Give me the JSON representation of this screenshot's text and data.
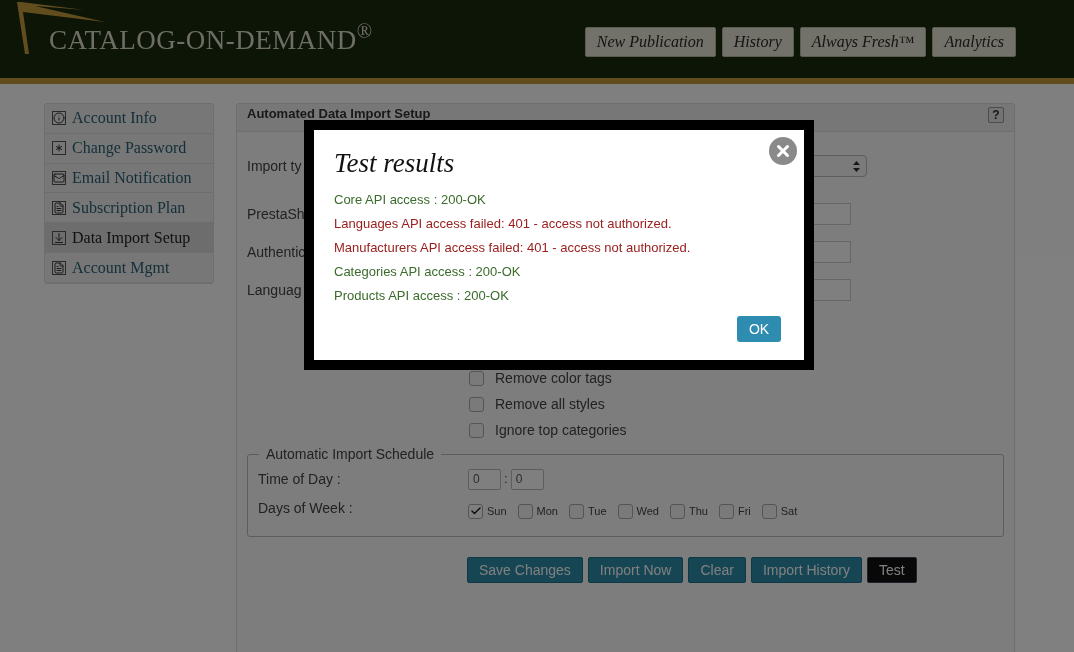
{
  "header": {
    "logo": "CATALOG-ON-DEMAND$^{®}$",
    "nav": [
      {
        "label": "New Publication"
      },
      {
        "label": "History"
      },
      {
        "label": "Always Fresh™"
      },
      {
        "label": "Analytics"
      }
    ]
  },
  "sidebar": {
    "items": [
      {
        "label": "Account Info",
        "selected": false
      },
      {
        "label": "Change Password",
        "selected": false
      },
      {
        "label": "Email Notification",
        "selected": false
      },
      {
        "label": "Subscription Plan",
        "selected": false
      },
      {
        "label": "Data Import Setup",
        "selected": true
      },
      {
        "label": "Account Mgmt",
        "selected": false
      }
    ]
  },
  "panel": {
    "title": "Automated Data Import Setup",
    "help": "?",
    "fields": [
      {
        "label": "Import ty",
        "kind": "select"
      },
      {
        "label": "PrestaSh",
        "kind": "input"
      },
      {
        "label": "Authentic",
        "kind": "input"
      },
      {
        "label": "Languag",
        "kind": "input"
      }
    ],
    "options": [
      {
        "label": "Remove color tags",
        "checked": false
      },
      {
        "label": "Remove all styles",
        "checked": false
      },
      {
        "label": "Ignore top categories",
        "checked": false
      }
    ],
    "schedule": {
      "legend": "Automatic Import Schedule",
      "time_label": "Time of Day :",
      "hour": "0",
      "separator": ":",
      "minute": "0",
      "days_label": "Days of Week :",
      "days": [
        {
          "label": "Sun",
          "checked": true
        },
        {
          "label": "Mon",
          "checked": false
        },
        {
          "label": "Tue",
          "checked": false
        },
        {
          "label": "Wed",
          "checked": false
        },
        {
          "label": "Thu",
          "checked": false
        },
        {
          "label": "Fri",
          "checked": false
        },
        {
          "label": "Sat",
          "checked": false
        }
      ]
    },
    "buttons": [
      {
        "label": "Save Changes",
        "kind": "primary"
      },
      {
        "label": "Import Now",
        "kind": "primary"
      },
      {
        "label": "Clear",
        "kind": "primary"
      },
      {
        "label": "Import History",
        "kind": "primary"
      },
      {
        "label": "Test",
        "kind": "dark"
      }
    ]
  },
  "dialog": {
    "title": "Test results",
    "results": [
      {
        "text": "Core API access : 200-OK",
        "kind": "ok"
      },
      {
        "text": "Languages API access failed: 401 - access not authorized.",
        "kind": "fail"
      },
      {
        "text": "Manufacturers API access failed: 401 - access not authorized.",
        "kind": "fail"
      },
      {
        "text": "Categories API access : 200-OK",
        "kind": "ok"
      },
      {
        "text": "Products API access : 200-OK",
        "kind": "ok"
      }
    ],
    "ok": "OK"
  }
}
